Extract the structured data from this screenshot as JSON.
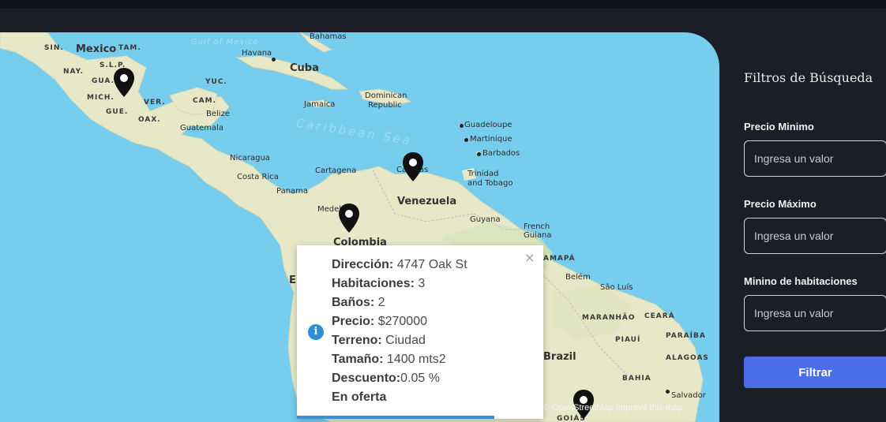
{
  "map": {
    "labels": {
      "mexico": "Mexico",
      "gulf": "Gulf of Mexico",
      "bahamas": "Bahamas",
      "havana": "Havana",
      "cuba": "Cuba",
      "dominican": "Dominican",
      "republic": "Republic",
      "jamaica": "Jamaica",
      "belize": "Belize",
      "guatemala": "Guatemala",
      "caribbean": "Caribbean Sea",
      "guadeloupe": "Guadeloupe",
      "martinique": "Martinique",
      "barbados": "Barbados",
      "nicaragua": "Nicaragua",
      "costa_rica": "Costa Rica",
      "cartagena": "Cartagena",
      "caracas": "Caracas",
      "trinidad1": "Trinidad",
      "trinidad2": "and Tobago",
      "panama": "Panama",
      "venezuela": "Venezuela",
      "medellin": "Medellín",
      "guyana": "Guyana",
      "french1": "French",
      "french2": "Guiana",
      "colombia": "Colombia",
      "amapa": "AMAPÁ",
      "belem": "Belém",
      "sao_luis": "São Luís",
      "maranhao": "MARANHÃO",
      "ceara": "CEARÁ",
      "piaui": "PIAUÍ",
      "paraiba": "PARAÍBA",
      "alagoas": "ALAGOAS",
      "brazil": "Brazil",
      "bahia": "BAHIA",
      "salvador": "Salvador",
      "goias": "GOIÁS",
      "sin": "SIN.",
      "tam": "TAM.",
      "nay": "NAY.",
      "slp": "S.L.P.",
      "gua": "GUA.",
      "yuc": "YUC.",
      "mich": "MICH.",
      "ver": "VER.",
      "cam": "CAM.",
      "gue": "GUE.",
      "oax": "OAX.",
      "ec": "E"
    },
    "attribution": "© OpenStreetMap  Improve this map"
  },
  "popup": {
    "direccion_label": "Dirección:",
    "direccion_value": " 4747 Oak St",
    "habitaciones_label": "Habitaciones:",
    "habitaciones_value": " 3",
    "banos_label": "Baños:",
    "banos_value": " 2",
    "precio_label": "Precio:",
    "precio_value": " $270000",
    "terreno_label": "Terreno:",
    "terreno_value": " Ciudad",
    "tamano_label": "Tamaño:",
    "tamano_value": " 1400 mts2",
    "descuento_label": "Descuento:",
    "descuento_value": "0.05 %",
    "oferta_label": "En oferta",
    "close_symbol": "×",
    "info_symbol": "i",
    "progress": 0.8
  },
  "filters": {
    "title": "Filtros de Búsqueda",
    "min_price_label": "Precio Minimo",
    "min_price_placeholder": "Ingresa un valor",
    "max_price_label": "Precio Máximo",
    "max_price_placeholder": "Ingresa un valor",
    "min_rooms_label": "Minino de habitaciones",
    "min_rooms_placeholder": "Ingresa un valor",
    "button_label": "Filtrar"
  },
  "colors": {
    "accent": "#4b6ee8",
    "water": "#76cdee",
    "land": "#e6e8c8",
    "sidebar": "#1b1e26"
  }
}
